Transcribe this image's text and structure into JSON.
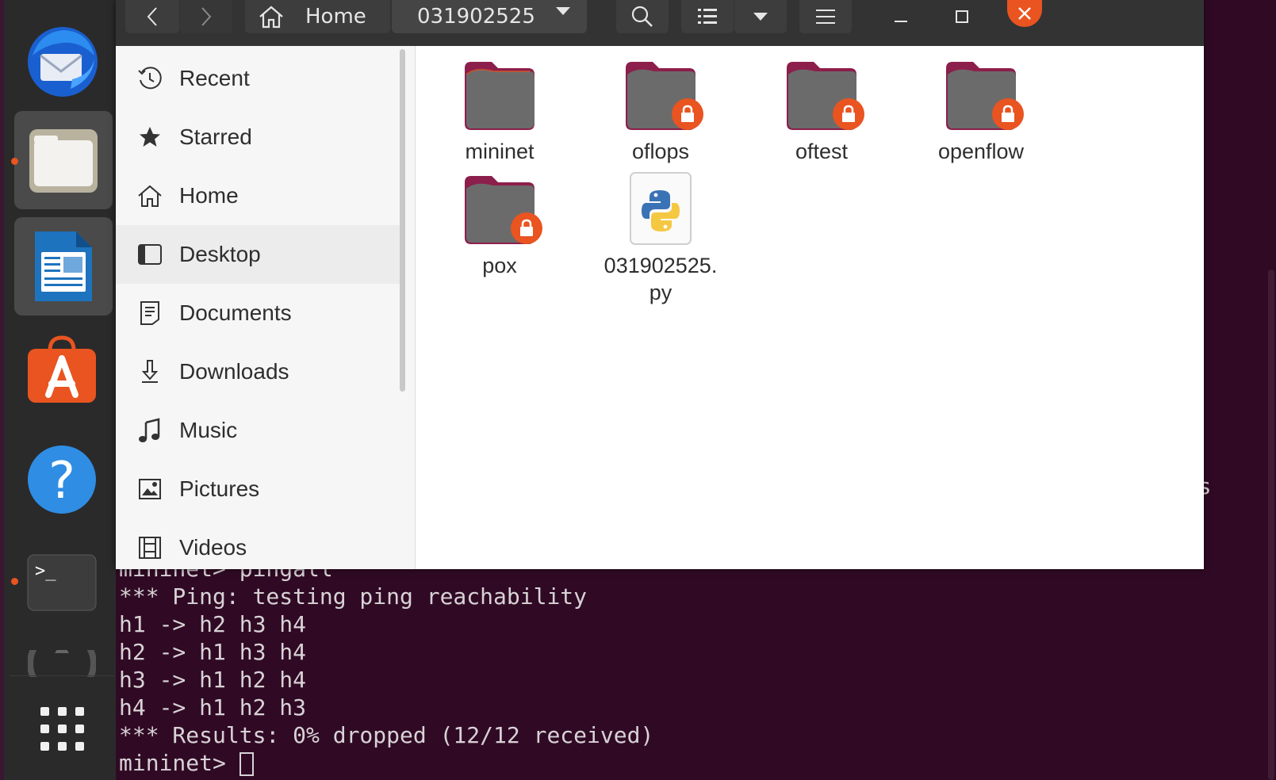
{
  "dock": {
    "items": [
      {
        "name": "thunderbird-launcher",
        "icon": "thunderbird-icon"
      },
      {
        "name": "files-launcher",
        "icon": "folder-icon",
        "running": true,
        "active": true
      },
      {
        "name": "libreoffice-writer-launcher",
        "icon": "writer-document-icon"
      },
      {
        "name": "ubuntu-software-launcher",
        "icon": "software-store-icon"
      },
      {
        "name": "help-launcher",
        "icon": "help-question-icon",
        "glyph": "?"
      },
      {
        "name": "terminal-launcher",
        "icon": "terminal-prompt-icon",
        "glyph": ">_",
        "running": true
      },
      {
        "name": "show-applications-button",
        "icon": "app-grid-icon"
      }
    ],
    "accent": "#e95420"
  },
  "files": {
    "path": {
      "home": "Home",
      "current": "031902525"
    },
    "sidebar": [
      {
        "label": "Recent",
        "icon": "clock-icon"
      },
      {
        "label": "Starred",
        "icon": "star-icon"
      },
      {
        "label": "Home",
        "icon": "home-icon"
      },
      {
        "label": "Desktop",
        "icon": "desktop-icon"
      },
      {
        "label": "Documents",
        "icon": "document-icon"
      },
      {
        "label": "Downloads",
        "icon": "download-icon"
      },
      {
        "label": "Music",
        "icon": "music-note-icon"
      },
      {
        "label": "Pictures",
        "icon": "picture-icon"
      },
      {
        "label": "Videos",
        "icon": "film-icon"
      }
    ],
    "items": [
      {
        "label": "mininet",
        "type": "folder",
        "locked": false
      },
      {
        "label": "oflops",
        "type": "folder",
        "locked": true
      },
      {
        "label": "oftest",
        "type": "folder",
        "locked": true
      },
      {
        "label": "openflow",
        "type": "folder",
        "locked": true
      },
      {
        "label": "pox",
        "type": "folder",
        "locked": true
      },
      {
        "label": "031902525.\npy",
        "type": "python-file",
        "locked": false
      }
    ]
  },
  "terminal": {
    "partial_line": "File exists",
    "lines": [
      "mininet> pingall",
      "*** Ping: testing ping reachability",
      "h1 -> h2 h3 h4",
      "h2 -> h1 h3 h4",
      "h3 -> h1 h2 h4",
      "h4 -> h1 h2 h3",
      "*** Results: 0% dropped (12/12 received)"
    ],
    "prompt": "mininet> ",
    "colors": {
      "background": "#300a24",
      "text": "#d8d2d6"
    }
  }
}
